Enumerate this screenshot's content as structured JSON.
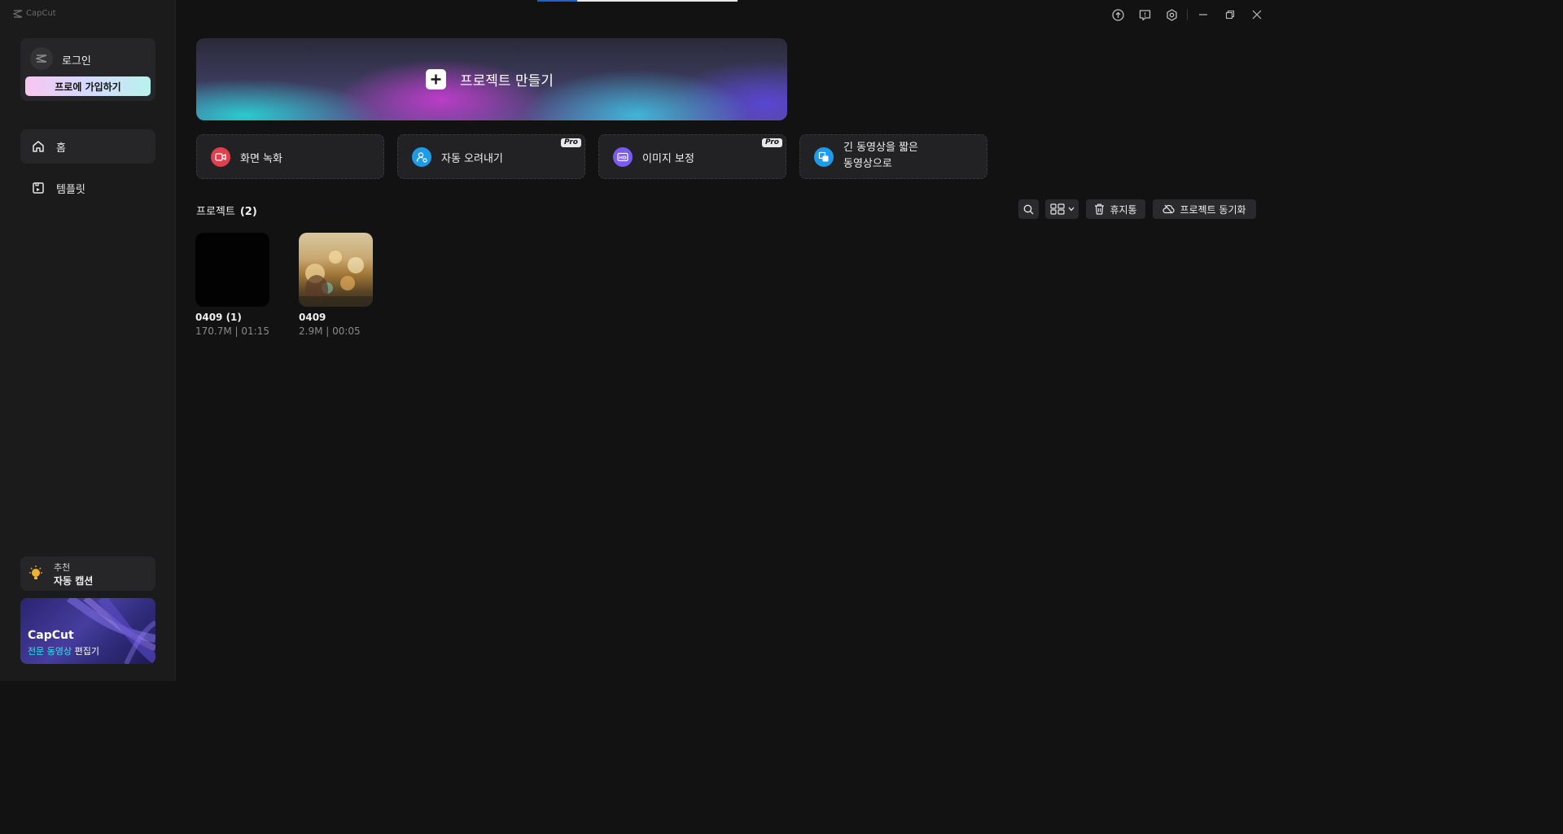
{
  "app": {
    "brand": "CapCut"
  },
  "sidebar": {
    "login_label": "로그인",
    "pro_button": "프로에 가입하기",
    "nav": [
      {
        "label": "홈",
        "icon": "home-icon",
        "active": true
      },
      {
        "label": "템플릿",
        "icon": "template-icon",
        "active": false
      }
    ],
    "recommend": {
      "small": "추천",
      "big": "자동 캡션"
    },
    "promo": {
      "title": "CapCut",
      "sub_highlight": "전문 동영상",
      "sub_rest": " 편집기"
    }
  },
  "main": {
    "create_project": "프로젝트 만들기",
    "tools": [
      {
        "label": "화면 녹화",
        "icon": "screen-record-icon",
        "color": "#e0404e",
        "pro": false
      },
      {
        "label": "자동 오려내기",
        "icon": "auto-cutout-icon",
        "color": "#1e9be8",
        "pro": true
      },
      {
        "label": "이미지 보정",
        "icon": "image-enhance-icon",
        "color": "#7a5af0",
        "pro": true
      },
      {
        "label_line1": "긴 동영상을 짧은",
        "label_line2": "동영상으로",
        "icon": "long-to-short-icon",
        "color": "#1e9be8",
        "pro": false
      }
    ],
    "pro_badge": "Pro",
    "projects_label": "프로젝트",
    "projects_count": "(2)",
    "trash_label": "휴지통",
    "sync_label": "프로젝트 동기화",
    "projects": [
      {
        "name": "0409 (1)",
        "meta": "170.7M | 01:15"
      },
      {
        "name": "0409",
        "meta": "2.9M | 00:05"
      }
    ]
  },
  "top_progress": 0.2
}
